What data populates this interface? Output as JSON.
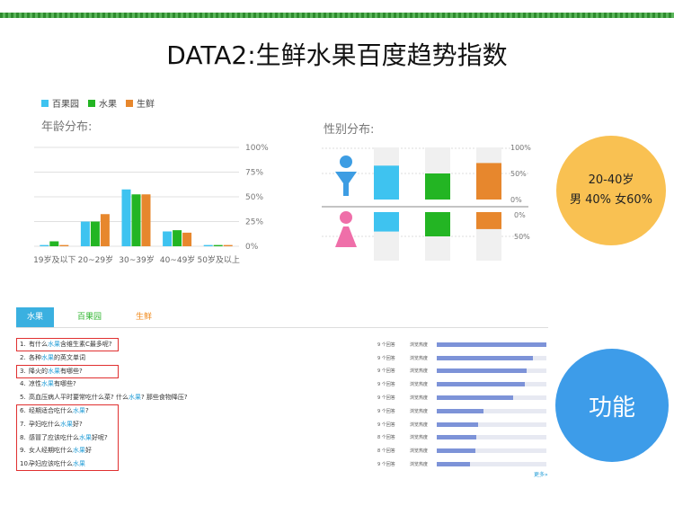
{
  "page_title": "DATA2:生鲜水果百度趋势指数",
  "legend": [
    {
      "name": "百果园",
      "color": "#3ec3f0"
    },
    {
      "name": "水果",
      "color": "#23b523"
    },
    {
      "name": "生鲜",
      "color": "#e7872d"
    }
  ],
  "age_section_label": "年龄分布:",
  "gender_section_label": "性别分布:",
  "chart_data": [
    {
      "type": "bar",
      "title": "年龄分布:",
      "categories": [
        "19岁及以下",
        "20~29岁",
        "30~39岁",
        "40~49岁",
        "50岁及以上"
      ],
      "series": [
        {
          "name": "百果园",
          "values": [
            0.5,
            10,
            23,
            6,
            0.5
          ]
        },
        {
          "name": "水果",
          "values": [
            2,
            10,
            21,
            6.5,
            0.5
          ]
        },
        {
          "name": "生鲜",
          "values": [
            0.5,
            13,
            21,
            5.5,
            0.5
          ]
        }
      ],
      "yticks": [
        "100%",
        "75%",
        "50%",
        "25%",
        "0%"
      ],
      "ylim": [
        0,
        40
      ],
      "grid": true
    },
    {
      "type": "bar",
      "title": "性别分布:",
      "categories": [
        "男",
        "女"
      ],
      "series": [
        {
          "name": "百果园",
          "values": [
            65,
            40
          ]
        },
        {
          "name": "水果",
          "values": [
            50,
            50
          ]
        },
        {
          "name": "生鲜",
          "values": [
            70,
            35
          ]
        }
      ],
      "yticks_upper": [
        "100%",
        "50%",
        "0%"
      ],
      "yticks_lower": [
        "0%",
        "50%"
      ],
      "ylim": [
        0,
        100
      ]
    }
  ],
  "yellow_circle": {
    "line1": "20-40岁",
    "line2": "男 40% 女60%"
  },
  "blue_circle": {
    "text": "功能"
  },
  "tabs": [
    "水果",
    "百果园",
    "生鲜"
  ],
  "questions": [
    {
      "num": "1.",
      "parts": [
        "有什么",
        "水果",
        "含维生素C最多呢?"
      ]
    },
    {
      "num": "2.",
      "parts": [
        "各种",
        "水果",
        "的英文单词"
      ]
    },
    {
      "num": "3.",
      "parts": [
        "降火的",
        "水果",
        "有哪些?"
      ]
    },
    {
      "num": "4.",
      "parts": [
        "凉性",
        "水果",
        "有哪些?"
      ]
    },
    {
      "num": "5.",
      "parts": [
        "高血压病人平时要常吃什么菜? 什么",
        "水果",
        "? 那些食物降压?"
      ]
    },
    {
      "num": "6.",
      "parts": [
        "经期适合吃什么",
        "水果",
        "?"
      ]
    },
    {
      "num": "7.",
      "parts": [
        "孕妇吃什么",
        "水果",
        "好?"
      ]
    },
    {
      "num": "8.",
      "parts": [
        "感冒了应该吃什么",
        "水果",
        "好呢?"
      ]
    },
    {
      "num": "9.",
      "parts": [
        "女人经期吃什么",
        "水果",
        "好"
      ]
    },
    {
      "num": "10.",
      "parts": [
        "孕妇应该吃什么",
        "水果",
        ""
      ]
    }
  ],
  "stats": [
    {
      "count": "9 个回答",
      "label": "浏览热度",
      "level": 1.0
    },
    {
      "count": "9 个回答",
      "label": "浏览热度",
      "level": 0.88
    },
    {
      "count": "9 个回答",
      "label": "浏览热度",
      "level": 0.82
    },
    {
      "count": "9 个回答",
      "label": "浏览热度",
      "level": 0.8
    },
    {
      "count": "9 个回答",
      "label": "浏览热度",
      "level": 0.7
    },
    {
      "count": "9 个回答",
      "label": "浏览热度",
      "level": 0.43
    },
    {
      "count": "9 个回答",
      "label": "浏览热度",
      "level": 0.38
    },
    {
      "count": "8 个回答",
      "label": "浏览热度",
      "level": 0.36
    },
    {
      "count": "8 个回答",
      "label": "浏览热度",
      "level": 0.35
    },
    {
      "count": "9 个回答",
      "label": "浏览热度",
      "level": 0.3
    }
  ],
  "more_link": "更多»",
  "icons": {
    "male": "male-person-icon",
    "female": "female-person-icon"
  },
  "colors": {
    "tab_active": "#3ab0e0",
    "keyword": "#2aa0d8",
    "stat_bar": "#7d93d8",
    "highlight_box": "#e03030"
  }
}
